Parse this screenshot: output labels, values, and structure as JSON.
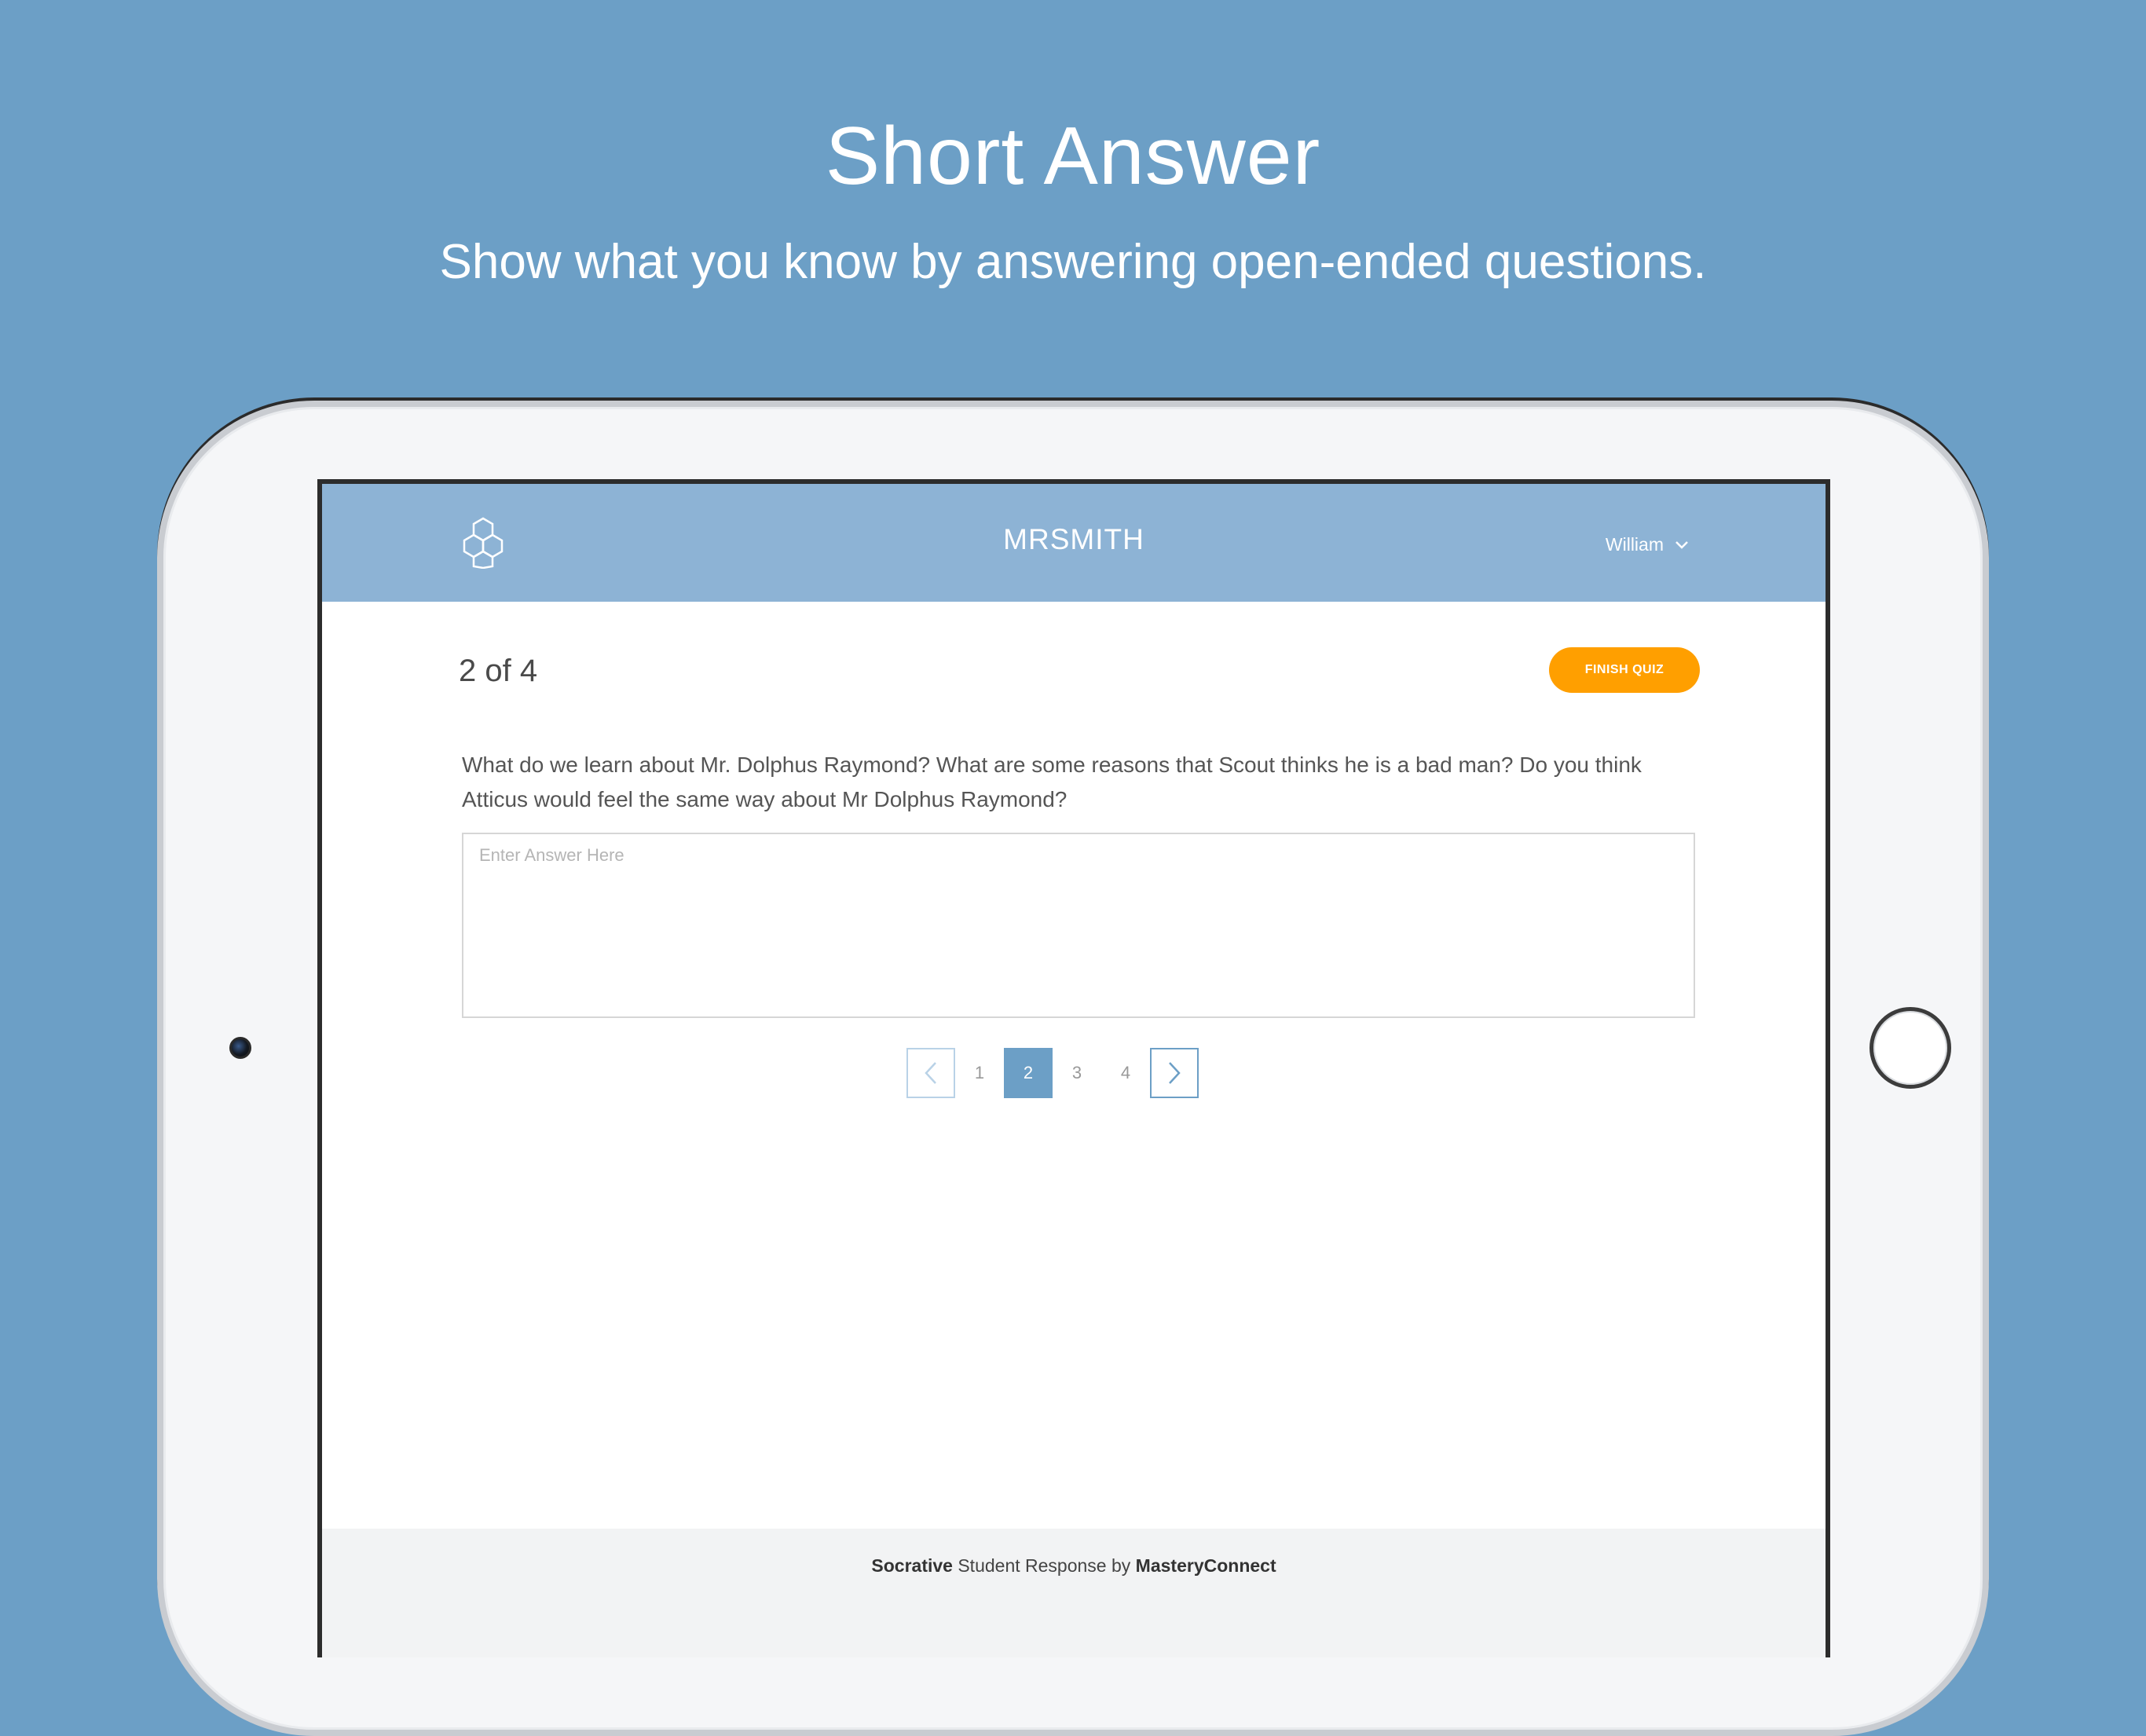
{
  "promo": {
    "title": "Short Answer",
    "subtitle": "Show what you know by answering open-ended questions."
  },
  "header": {
    "room_name": "MRSMITH",
    "user_name": "William"
  },
  "quiz": {
    "progress": "2 of 4",
    "finish_label": "FINISH QUIZ",
    "question": "What do we learn about Mr. Dolphus Raymond? What are some reasons that Scout thinks he is a bad man? Do you think Atticus would feel the same way about Mr Dolphus Raymond?",
    "answer_placeholder": "Enter Answer Here",
    "answer_value": ""
  },
  "pager": {
    "pages": [
      "1",
      "2",
      "3",
      "4"
    ],
    "current": "2"
  },
  "footer": {
    "brand": "Socrative",
    "middle": " Student Response by ",
    "company": "MasteryConnect"
  },
  "colors": {
    "background": "#6c9fc6",
    "header": "#8db3d5",
    "accent": "#ff9f00",
    "active_page": "#6c9fc6"
  },
  "icons": {
    "logo": "socrative-hexagon-logo-icon",
    "user_menu": "chevron-down-icon",
    "prev": "chevron-left-icon",
    "next": "chevron-right-icon"
  }
}
